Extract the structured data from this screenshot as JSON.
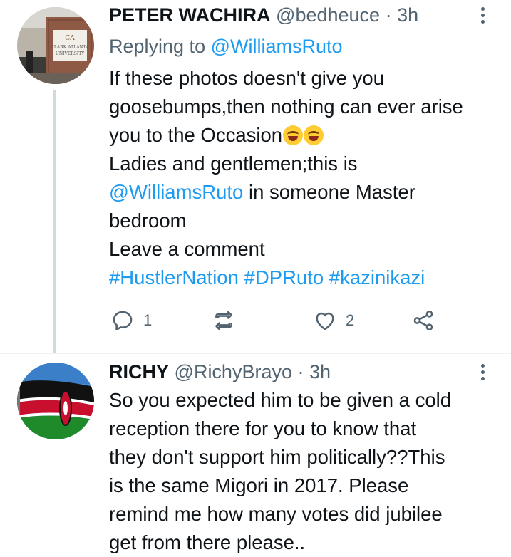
{
  "tweets": [
    {
      "name": "PETER WACHIRA",
      "handle": "@bedheuce",
      "separator": "·",
      "time": "3h",
      "replying_prefix": "Replying to",
      "replying_handle": "@WilliamsRuto",
      "body": {
        "l1": "If these photos doesn't give you",
        "l2": "goosebumps,then nothing can ever arise",
        "l3": "you to the Occasion",
        "l4": "Ladies and gentlemen;this is",
        "l5_mention": "@WilliamsRuto",
        "l5_rest": " in someone Master",
        "l6": "bedroom",
        "l7": "Leave a comment",
        "tag1": "#HustlerNation",
        "tag2": "#DPRuto",
        "tag3": "#kazinikazi"
      },
      "emoji": "rolling-on-floor-laughing",
      "avatar_icon": "university-sign-photo",
      "reply_count": "1",
      "retweet_count": "",
      "like_count": "2"
    },
    {
      "name": "RICHY",
      "handle": "@RichyBrayo",
      "separator": "·",
      "time": "3h",
      "avatar_icon": "kenya-flag-photo",
      "body": {
        "l1": "So you expected him to be given a cold",
        "l2": "reception there for you to know that",
        "l3": "they don't support him politically??This",
        "l4": "is the same Migori in 2017. Please",
        "l5": "remind me how many votes did jubilee",
        "l6": "get from there please.."
      }
    }
  ],
  "colors": {
    "text": "#0f1419",
    "secondary": "#536471",
    "link": "#1d9bf0",
    "thread_line": "#cfd9de"
  }
}
